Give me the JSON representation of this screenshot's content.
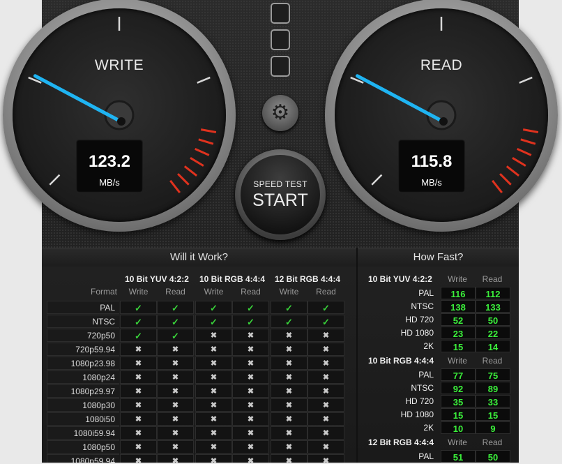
{
  "gauges": {
    "write": {
      "label": "WRITE",
      "value": "123.2",
      "unit": "MB/s",
      "fraction": 0.12
    },
    "read": {
      "label": "READ",
      "value": "115.8",
      "unit": "MB/s",
      "fraction": 0.11
    }
  },
  "start_button": {
    "line1": "SPEED TEST",
    "line2": "START"
  },
  "colors": {
    "needle": "#1fb4f2",
    "redline": "#e0321e",
    "ok": "#39d33a",
    "fast": "#3bf03b"
  },
  "will_it_work": {
    "title": "Will it Work?",
    "format_label": "Format",
    "groups": [
      {
        "name": "10 Bit YUV 4:2:2",
        "write": "Write",
        "read": "Read"
      },
      {
        "name": "10 Bit RGB 4:4:4",
        "write": "Write",
        "read": "Read"
      },
      {
        "name": "12 Bit RGB 4:4:4",
        "write": "Write",
        "read": "Read"
      }
    ],
    "rows": [
      {
        "format": "PAL",
        "ok": [
          true,
          true,
          true,
          true,
          true,
          true
        ]
      },
      {
        "format": "NTSC",
        "ok": [
          true,
          true,
          true,
          true,
          true,
          true
        ]
      },
      {
        "format": "720p50",
        "ok": [
          true,
          true,
          false,
          false,
          false,
          false
        ]
      },
      {
        "format": "720p59.94",
        "ok": [
          false,
          false,
          false,
          false,
          false,
          false
        ]
      },
      {
        "format": "1080p23.98",
        "ok": [
          false,
          false,
          false,
          false,
          false,
          false
        ]
      },
      {
        "format": "1080p24",
        "ok": [
          false,
          false,
          false,
          false,
          false,
          false
        ]
      },
      {
        "format": "1080p29.97",
        "ok": [
          false,
          false,
          false,
          false,
          false,
          false
        ]
      },
      {
        "format": "1080p30",
        "ok": [
          false,
          false,
          false,
          false,
          false,
          false
        ]
      },
      {
        "format": "1080i50",
        "ok": [
          false,
          false,
          false,
          false,
          false,
          false
        ]
      },
      {
        "format": "1080i59.94",
        "ok": [
          false,
          false,
          false,
          false,
          false,
          false
        ]
      },
      {
        "format": "1080p50",
        "ok": [
          false,
          false,
          false,
          false,
          false,
          false
        ]
      },
      {
        "format": "1080p59.94",
        "ok": [
          false,
          false,
          false,
          false,
          false,
          false
        ]
      }
    ]
  },
  "how_fast": {
    "title": "How Fast?",
    "sections": [
      {
        "name": "10 Bit YUV 4:2:2",
        "write": "Write",
        "read": "Read",
        "rows": [
          {
            "label": "PAL",
            "write": "116",
            "read": "112"
          },
          {
            "label": "NTSC",
            "write": "138",
            "read": "133"
          },
          {
            "label": "HD 720",
            "write": "52",
            "read": "50"
          },
          {
            "label": "HD 1080",
            "write": "23",
            "read": "22"
          },
          {
            "label": "2K",
            "write": "15",
            "read": "14"
          }
        ]
      },
      {
        "name": "10 Bit RGB 4:4:4",
        "write": "Write",
        "read": "Read",
        "rows": [
          {
            "label": "PAL",
            "write": "77",
            "read": "75"
          },
          {
            "label": "NTSC",
            "write": "92",
            "read": "89"
          },
          {
            "label": "HD 720",
            "write": "35",
            "read": "33"
          },
          {
            "label": "HD 1080",
            "write": "15",
            "read": "15"
          },
          {
            "label": "2K",
            "write": "10",
            "read": "9"
          }
        ]
      },
      {
        "name": "12 Bit RGB 4:4:4",
        "write": "Write",
        "read": "Read",
        "rows": [
          {
            "label": "PAL",
            "write": "51",
            "read": "50"
          }
        ]
      }
    ]
  }
}
